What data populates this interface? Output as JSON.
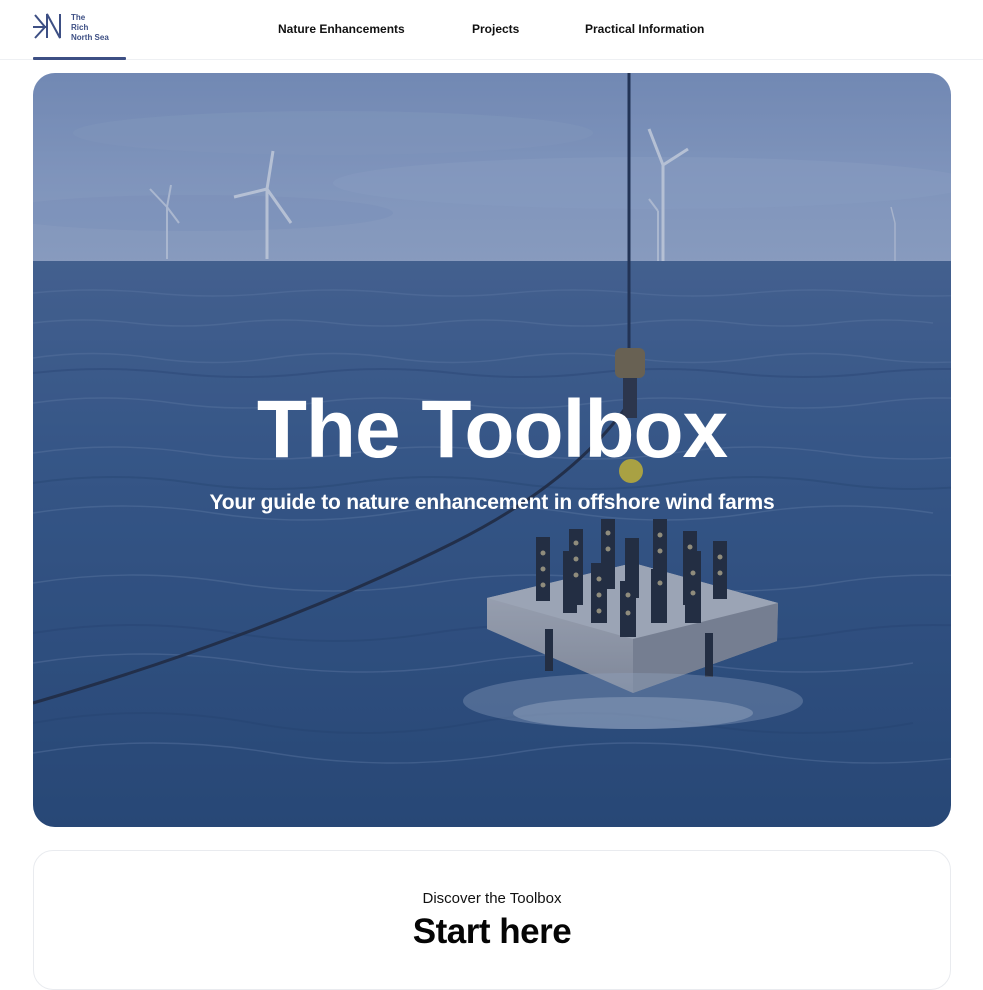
{
  "header": {
    "logo": {
      "line1": "The",
      "line2": "Rich",
      "line3": "North Sea",
      "icon": "rns-logo-icon"
    },
    "nav": [
      {
        "label": "Nature Enhancements"
      },
      {
        "label": "Projects"
      },
      {
        "label": "Practical Information"
      }
    ]
  },
  "hero": {
    "title": "The Toolbox",
    "subtitle": "Your guide to nature enhancement in offshore wind farms",
    "image": "offshore-wind-farm-reef-structure-photo"
  },
  "discover": {
    "kicker": "Discover the Toolbox",
    "title": "Start here"
  },
  "colors": {
    "brand": "#3d4f84",
    "sea": "#2f4f7e",
    "sky": "#7f97c0",
    "text": "#0a0a0a"
  }
}
